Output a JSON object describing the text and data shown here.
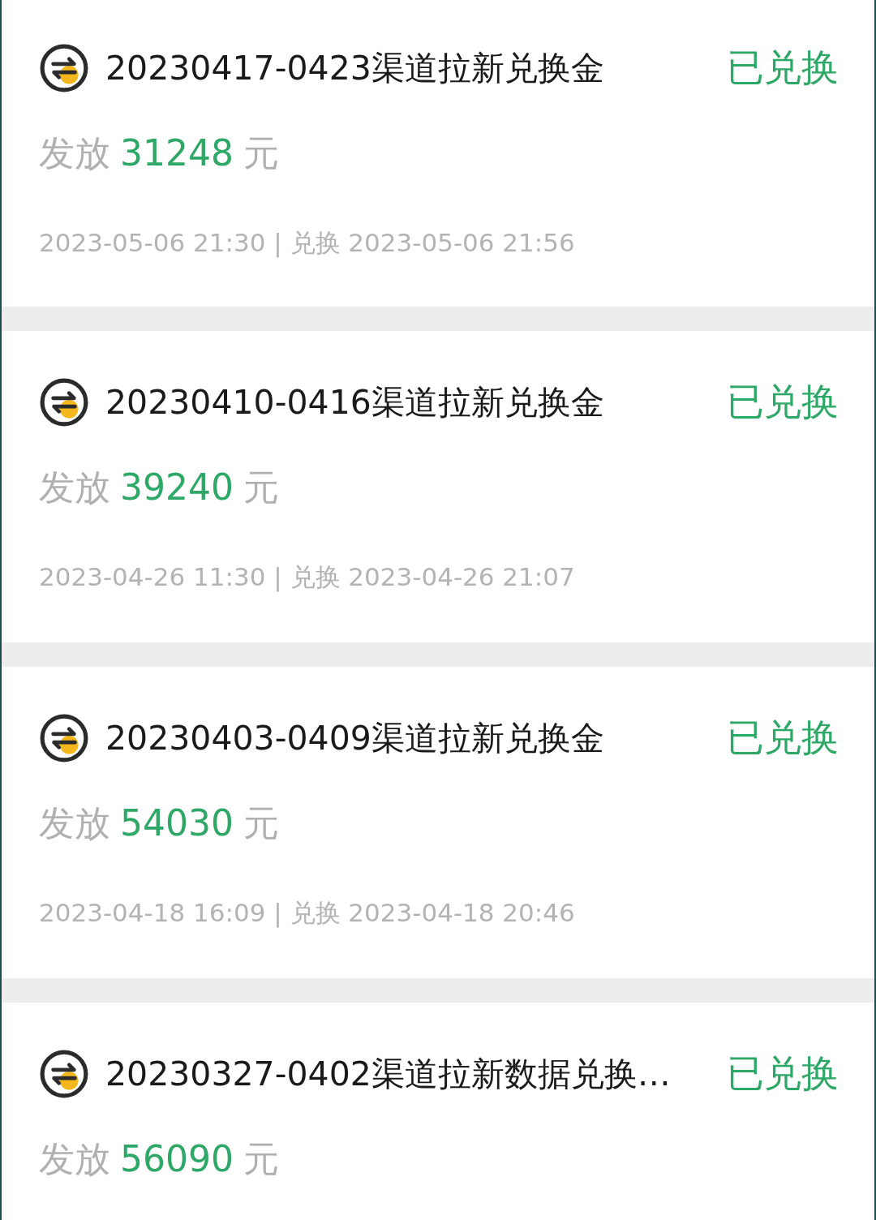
{
  "records": [
    {
      "title": "20230417-0423渠道拉新兑换金",
      "status": "已兑换",
      "amount_prefix": "发放",
      "amount": "31248",
      "amount_unit": "元",
      "times": "2023-05-06 21:30 | 兑换 2023-05-06 21:56"
    },
    {
      "title": "20230410-0416渠道拉新兑换金",
      "status": "已兑换",
      "amount_prefix": "发放",
      "amount": "39240",
      "amount_unit": "元",
      "times": "2023-04-26 11:30 | 兑换 2023-04-26 21:07"
    },
    {
      "title": "20230403-0409渠道拉新兑换金",
      "status": "已兑换",
      "amount_prefix": "发放",
      "amount": "54030",
      "amount_unit": "元",
      "times": "2023-04-18 16:09 | 兑换 2023-04-18 20:46"
    },
    {
      "title": "20230327-0402渠道拉新数据兑换…",
      "status": "已兑换",
      "amount_prefix": "发放",
      "amount": "56090",
      "amount_unit": "元"
    }
  ]
}
